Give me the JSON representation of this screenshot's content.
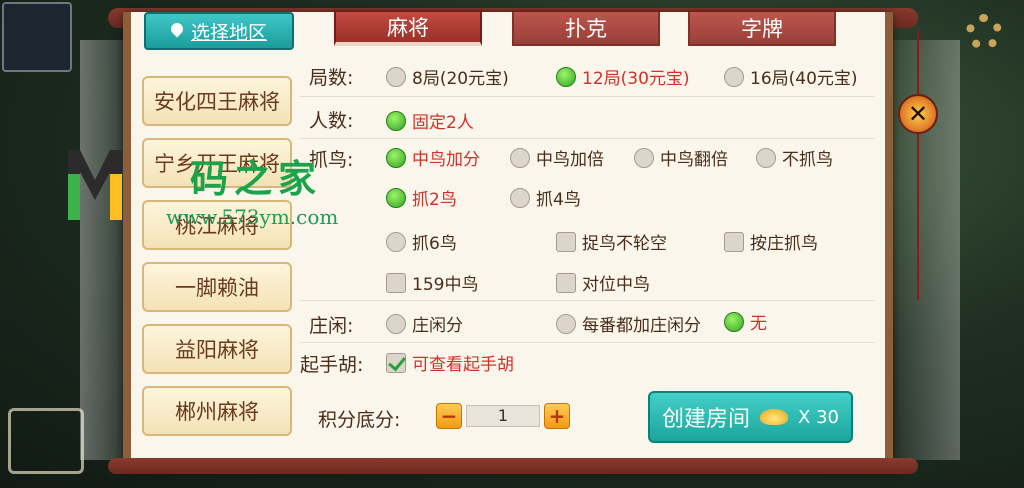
{
  "region": {
    "label": "选择地区"
  },
  "tabs": [
    {
      "label": "麻将",
      "active": true
    },
    {
      "label": "扑克",
      "active": false
    },
    {
      "label": "字牌",
      "active": false
    }
  ],
  "sidebar": {
    "items": [
      {
        "label": "安化四王麻将"
      },
      {
        "label": "宁乡开王麻将"
      },
      {
        "label": "桃江麻将"
      },
      {
        "label": "一脚赖油"
      },
      {
        "label": "益阳麻将"
      },
      {
        "label": "郴州麻将"
      }
    ]
  },
  "rounds": {
    "label": "局数:",
    "options": [
      {
        "label": "8局(20元宝)",
        "selected": false
      },
      {
        "label": "12局(30元宝)",
        "selected": true
      },
      {
        "label": "16局(40元宝)",
        "selected": false
      }
    ]
  },
  "players": {
    "label": "人数:",
    "options": [
      {
        "label": "固定2人",
        "selected": true
      }
    ]
  },
  "catch_bird": {
    "label": "抓鸟:",
    "mode_options": [
      {
        "label": "中鸟加分",
        "selected": true
      },
      {
        "label": "中鸟加倍",
        "selected": false
      },
      {
        "label": "中鸟翻倍",
        "selected": false
      },
      {
        "label": "不抓鸟",
        "selected": false
      }
    ],
    "count_options": [
      {
        "label": "抓2鸟",
        "selected": true
      },
      {
        "label": "抓4鸟",
        "selected": false
      },
      {
        "label": "抓6鸟",
        "selected": false
      }
    ],
    "extra_options": [
      {
        "label": "捉鸟不轮空",
        "checked": false
      },
      {
        "label": "按庄抓鸟",
        "checked": false
      },
      {
        "label": "159中鸟",
        "checked": false
      },
      {
        "label": "对位中鸟",
        "checked": false
      }
    ]
  },
  "dealer": {
    "label": "庄闲:",
    "options": [
      {
        "label": "庄闲分",
        "selected": false
      },
      {
        "label": "每番都加庄闲分",
        "selected": false
      },
      {
        "label": "无",
        "selected": true
      }
    ]
  },
  "starting_hu": {
    "label": "起手胡:",
    "option": {
      "label": "可查看起手胡",
      "checked": true
    }
  },
  "score": {
    "label": "积分底分:",
    "minus": "−",
    "plus": "+",
    "value": "1"
  },
  "create": {
    "label": "创建房间",
    "cost": "X 30"
  },
  "close": {
    "symbol": "✕"
  },
  "watermark": {
    "text": "码之家",
    "url": "www.573ym.com"
  },
  "colors": {
    "accent_teal": "#1da59b",
    "tab_red": "#9b302a",
    "selected_red": "#d3302a"
  }
}
